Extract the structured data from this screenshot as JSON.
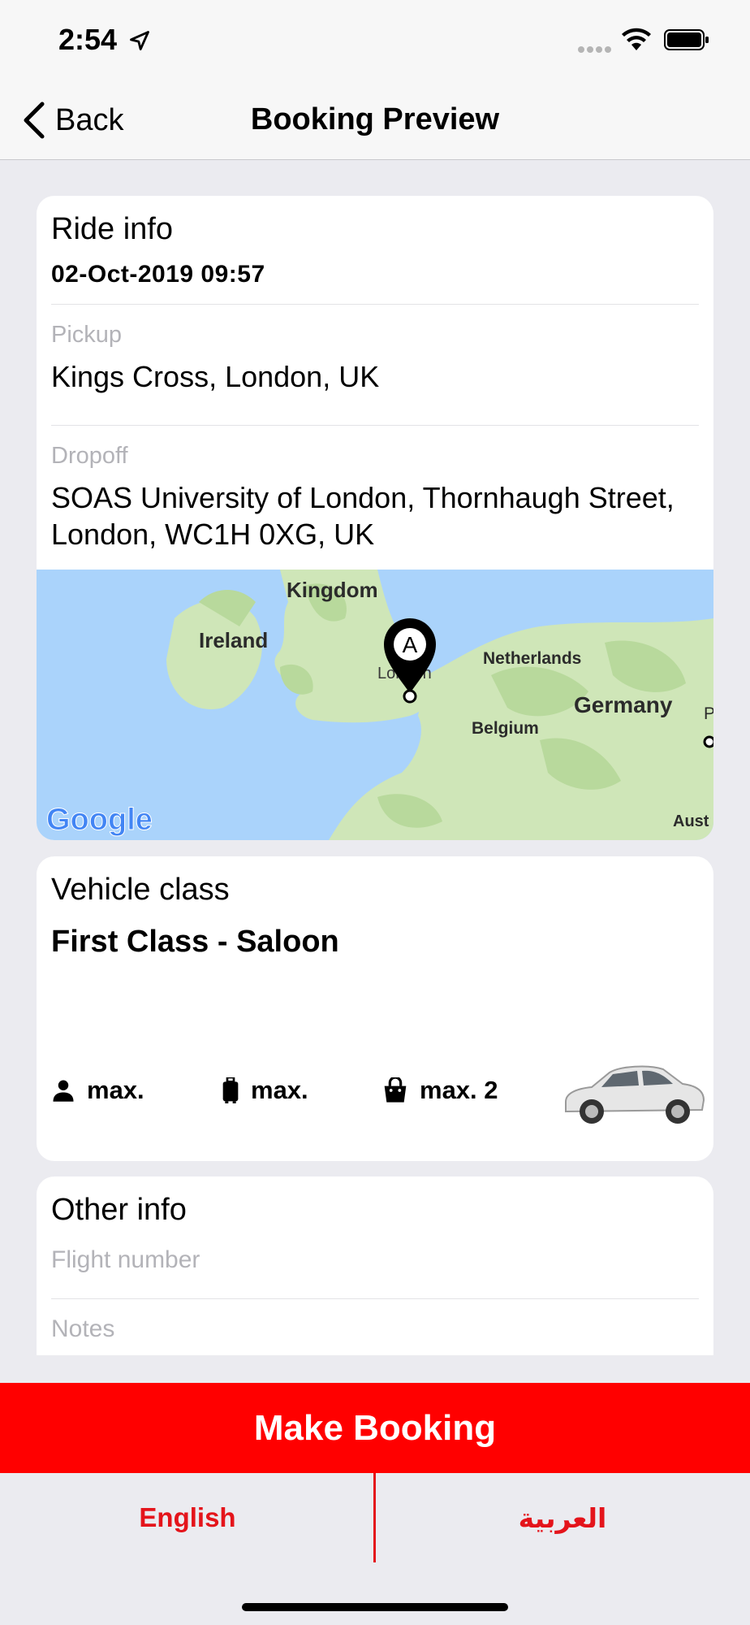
{
  "status_bar": {
    "time": "2:54"
  },
  "nav": {
    "back_label": "Back",
    "title": "Booking Preview"
  },
  "ride_info": {
    "heading": "Ride info",
    "datetime": "02-Oct-2019 09:57",
    "pickup_label": "Pickup",
    "pickup_value": "Kings Cross, London, UK",
    "dropoff_label": "Dropoff",
    "dropoff_value": "SOAS University of London, Thornhaugh Street, London,  WC1H 0XG, UK"
  },
  "map": {
    "labels": {
      "kingdom": "Kingdom",
      "ireland": "Ireland",
      "netherlands": "Netherlands",
      "london": "London",
      "germany": "Germany",
      "belgium": "Belgium",
      "austria_partial": "Aust",
      "edge_partial": "P"
    },
    "marker_letter": "A",
    "attribution": "Google",
    "colors": {
      "water": "#aad3fb",
      "land": "#cfe6b8",
      "land_dark": "#b8d99c"
    }
  },
  "vehicle": {
    "heading": "Vehicle class",
    "class_name": "First Class - Saloon",
    "passengers": "max.",
    "luggage": "max.",
    "hand_luggage": "max. 2",
    "icons": [
      "person-icon",
      "suitcase-icon",
      "bag-icon"
    ]
  },
  "other_info": {
    "heading": "Other info",
    "flight_placeholder": "Flight number",
    "notes_placeholder": "Notes"
  },
  "actions": {
    "make_booking": "Make Booking"
  },
  "language": {
    "english": "English",
    "arabic": "العربية"
  },
  "colors": {
    "accent": "#ff0000",
    "language_text": "#e4141b"
  }
}
